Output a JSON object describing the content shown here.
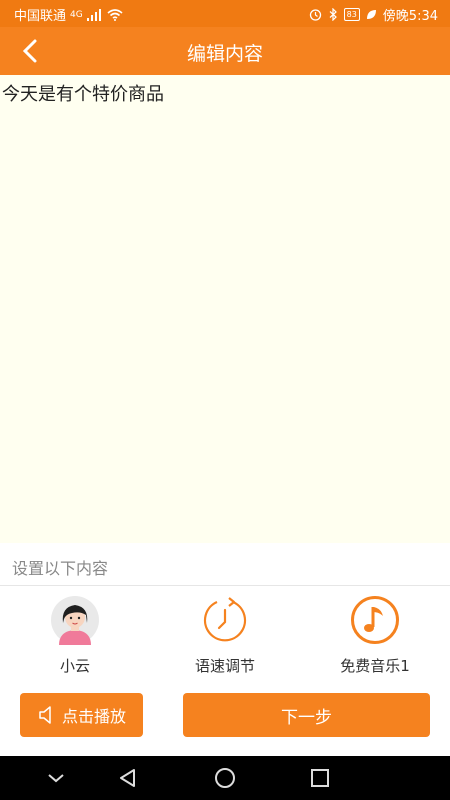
{
  "status_bar": {
    "carrier": "中国联通",
    "network_badge": "4G",
    "battery": "83",
    "time": "傍晚5:34",
    "icons": [
      "signal-icon",
      "wifi-icon",
      "alarm-icon",
      "bluetooth-icon",
      "battery-icon",
      "leaf-icon"
    ]
  },
  "header": {
    "title": "编辑内容",
    "back_icon": "back-arrow-icon"
  },
  "editor": {
    "content": "今天是有个特价商品"
  },
  "settings": {
    "label": "设置以下内容",
    "options": [
      {
        "label": "小云",
        "icon": "avatar-girl-icon"
      },
      {
        "label": "语速调节",
        "icon": "speed-clock-icon"
      },
      {
        "label": "免费音乐1",
        "icon": "music-note-icon"
      }
    ]
  },
  "actions": {
    "play_label": "点击播放",
    "play_icon": "speaker-icon",
    "next_label": "下一步"
  },
  "nav": {
    "icons": [
      "collapse-icon",
      "back-icon",
      "home-icon",
      "recents-icon"
    ]
  },
  "colors": {
    "accent": "#f5821f",
    "status_bar": "#f07a12",
    "editor_bg": "#fffff0"
  }
}
